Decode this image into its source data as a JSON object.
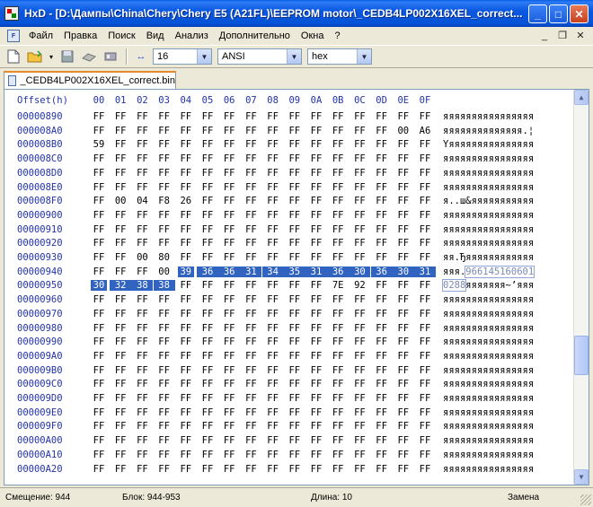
{
  "window": {
    "title": "HxD - [D:\\Дампы\\China\\Chery\\Chery E5 (A21FL)\\EEPROM motor\\_CEDB4LP002X16XEL_correct...",
    "minimize": "_",
    "maximize": "□",
    "close": "✕"
  },
  "menu": {
    "items": [
      "Файл",
      "Правка",
      "Поиск",
      "Вид",
      "Анализ",
      "Дополнительно",
      "Окна",
      "?"
    ],
    "mdi_min": "_",
    "mdi_restore": "❐",
    "mdi_close": "✕"
  },
  "toolbar": {
    "bytes_per_row": "16",
    "charset": "ANSI",
    "offset_base": "hex"
  },
  "tab": {
    "label": "_CEDB4LP002X16XEL_correct.bin"
  },
  "editor": {
    "offset_header": "Offset(h)",
    "columns": [
      "00",
      "01",
      "02",
      "03",
      "04",
      "05",
      "06",
      "07",
      "08",
      "09",
      "0A",
      "0B",
      "0C",
      "0D",
      "0E",
      "0F"
    ],
    "rows": [
      {
        "offset": "00000890",
        "bytes": [
          "FF",
          "FF",
          "FF",
          "FF",
          "FF",
          "FF",
          "FF",
          "FF",
          "FF",
          "FF",
          "FF",
          "FF",
          "FF",
          "FF",
          "FF",
          "FF"
        ],
        "ascii": "яяяяяяяяяяяяяяяя"
      },
      {
        "offset": "000008A0",
        "bytes": [
          "FF",
          "FF",
          "FF",
          "FF",
          "FF",
          "FF",
          "FF",
          "FF",
          "FF",
          "FF",
          "FF",
          "FF",
          "FF",
          "FF",
          "00",
          "A6"
        ],
        "ascii": "яяяяяяяяяяяяяя.¦"
      },
      {
        "offset": "000008B0",
        "bytes": [
          "59",
          "FF",
          "FF",
          "FF",
          "FF",
          "FF",
          "FF",
          "FF",
          "FF",
          "FF",
          "FF",
          "FF",
          "FF",
          "FF",
          "FF",
          "FF"
        ],
        "ascii": "Yяяяяяяяяяяяяяяя"
      },
      {
        "offset": "000008C0",
        "bytes": [
          "FF",
          "FF",
          "FF",
          "FF",
          "FF",
          "FF",
          "FF",
          "FF",
          "FF",
          "FF",
          "FF",
          "FF",
          "FF",
          "FF",
          "FF",
          "FF"
        ],
        "ascii": "яяяяяяяяяяяяяяяя"
      },
      {
        "offset": "000008D0",
        "bytes": [
          "FF",
          "FF",
          "FF",
          "FF",
          "FF",
          "FF",
          "FF",
          "FF",
          "FF",
          "FF",
          "FF",
          "FF",
          "FF",
          "FF",
          "FF",
          "FF"
        ],
        "ascii": "яяяяяяяяяяяяяяяя"
      },
      {
        "offset": "000008E0",
        "bytes": [
          "FF",
          "FF",
          "FF",
          "FF",
          "FF",
          "FF",
          "FF",
          "FF",
          "FF",
          "FF",
          "FF",
          "FF",
          "FF",
          "FF",
          "FF",
          "FF"
        ],
        "ascii": "яяяяяяяяяяяяяяяя"
      },
      {
        "offset": "000008F0",
        "bytes": [
          "FF",
          "00",
          "04",
          "F8",
          "26",
          "FF",
          "FF",
          "FF",
          "FF",
          "FF",
          "FF",
          "FF",
          "FF",
          "FF",
          "FF",
          "FF"
        ],
        "ascii": "я..ш&яяяяяяяяяяя"
      },
      {
        "offset": "00000900",
        "bytes": [
          "FF",
          "FF",
          "FF",
          "FF",
          "FF",
          "FF",
          "FF",
          "FF",
          "FF",
          "FF",
          "FF",
          "FF",
          "FF",
          "FF",
          "FF",
          "FF"
        ],
        "ascii": "яяяяяяяяяяяяяяяя"
      },
      {
        "offset": "00000910",
        "bytes": [
          "FF",
          "FF",
          "FF",
          "FF",
          "FF",
          "FF",
          "FF",
          "FF",
          "FF",
          "FF",
          "FF",
          "FF",
          "FF",
          "FF",
          "FF",
          "FF"
        ],
        "ascii": "яяяяяяяяяяяяяяяя"
      },
      {
        "offset": "00000920",
        "bytes": [
          "FF",
          "FF",
          "FF",
          "FF",
          "FF",
          "FF",
          "FF",
          "FF",
          "FF",
          "FF",
          "FF",
          "FF",
          "FF",
          "FF",
          "FF",
          "FF"
        ],
        "ascii": "яяяяяяяяяяяяяяяя"
      },
      {
        "offset": "00000930",
        "bytes": [
          "FF",
          "FF",
          "00",
          "80",
          "FF",
          "FF",
          "FF",
          "FF",
          "FF",
          "FF",
          "FF",
          "FF",
          "FF",
          "FF",
          "FF",
          "FF"
        ],
        "ascii": "яя.Ђяяяяяяяяяяяя"
      },
      {
        "offset": "00000940",
        "bytes": [
          "FF",
          "FF",
          "FF",
          "00",
          "39",
          "36",
          "36",
          "31",
          "34",
          "35",
          "31",
          "36",
          "30",
          "36",
          "30",
          "31"
        ],
        "ascii_plain": "яяя.",
        "ascii_sel": "966145160601"
      },
      {
        "offset": "00000950",
        "bytes": [
          "30",
          "32",
          "38",
          "38",
          "FF",
          "FF",
          "FF",
          "FF",
          "FF",
          "FF",
          "FF",
          "7E",
          "92",
          "FF",
          "FF",
          "FF"
        ],
        "ascii_sel": "0288",
        "ascii_plain": "яяяяяяя~’яяя"
      },
      {
        "offset": "00000960",
        "bytes": [
          "FF",
          "FF",
          "FF",
          "FF",
          "FF",
          "FF",
          "FF",
          "FF",
          "FF",
          "FF",
          "FF",
          "FF",
          "FF",
          "FF",
          "FF",
          "FF"
        ],
        "ascii": "яяяяяяяяяяяяяяяя"
      },
      {
        "offset": "00000970",
        "bytes": [
          "FF",
          "FF",
          "FF",
          "FF",
          "FF",
          "FF",
          "FF",
          "FF",
          "FF",
          "FF",
          "FF",
          "FF",
          "FF",
          "FF",
          "FF",
          "FF"
        ],
        "ascii": "яяяяяяяяяяяяяяяя"
      },
      {
        "offset": "00000980",
        "bytes": [
          "FF",
          "FF",
          "FF",
          "FF",
          "FF",
          "FF",
          "FF",
          "FF",
          "FF",
          "FF",
          "FF",
          "FF",
          "FF",
          "FF",
          "FF",
          "FF"
        ],
        "ascii": "яяяяяяяяяяяяяяяя"
      },
      {
        "offset": "00000990",
        "bytes": [
          "FF",
          "FF",
          "FF",
          "FF",
          "FF",
          "FF",
          "FF",
          "FF",
          "FF",
          "FF",
          "FF",
          "FF",
          "FF",
          "FF",
          "FF",
          "FF"
        ],
        "ascii": "яяяяяяяяяяяяяяяя"
      },
      {
        "offset": "000009A0",
        "bytes": [
          "FF",
          "FF",
          "FF",
          "FF",
          "FF",
          "FF",
          "FF",
          "FF",
          "FF",
          "FF",
          "FF",
          "FF",
          "FF",
          "FF",
          "FF",
          "FF"
        ],
        "ascii": "яяяяяяяяяяяяяяяя"
      },
      {
        "offset": "000009B0",
        "bytes": [
          "FF",
          "FF",
          "FF",
          "FF",
          "FF",
          "FF",
          "FF",
          "FF",
          "FF",
          "FF",
          "FF",
          "FF",
          "FF",
          "FF",
          "FF",
          "FF"
        ],
        "ascii": "яяяяяяяяяяяяяяяя"
      },
      {
        "offset": "000009C0",
        "bytes": [
          "FF",
          "FF",
          "FF",
          "FF",
          "FF",
          "FF",
          "FF",
          "FF",
          "FF",
          "FF",
          "FF",
          "FF",
          "FF",
          "FF",
          "FF",
          "FF"
        ],
        "ascii": "яяяяяяяяяяяяяяяя"
      },
      {
        "offset": "000009D0",
        "bytes": [
          "FF",
          "FF",
          "FF",
          "FF",
          "FF",
          "FF",
          "FF",
          "FF",
          "FF",
          "FF",
          "FF",
          "FF",
          "FF",
          "FF",
          "FF",
          "FF"
        ],
        "ascii": "яяяяяяяяяяяяяяяя"
      },
      {
        "offset": "000009E0",
        "bytes": [
          "FF",
          "FF",
          "FF",
          "FF",
          "FF",
          "FF",
          "FF",
          "FF",
          "FF",
          "FF",
          "FF",
          "FF",
          "FF",
          "FF",
          "FF",
          "FF"
        ],
        "ascii": "яяяяяяяяяяяяяяяя"
      },
      {
        "offset": "000009F0",
        "bytes": [
          "FF",
          "FF",
          "FF",
          "FF",
          "FF",
          "FF",
          "FF",
          "FF",
          "FF",
          "FF",
          "FF",
          "FF",
          "FF",
          "FF",
          "FF",
          "FF"
        ],
        "ascii": "яяяяяяяяяяяяяяяя"
      },
      {
        "offset": "00000A00",
        "bytes": [
          "FF",
          "FF",
          "FF",
          "FF",
          "FF",
          "FF",
          "FF",
          "FF",
          "FF",
          "FF",
          "FF",
          "FF",
          "FF",
          "FF",
          "FF",
          "FF"
        ],
        "ascii": "яяяяяяяяяяяяяяяя"
      },
      {
        "offset": "00000A10",
        "bytes": [
          "FF",
          "FF",
          "FF",
          "FF",
          "FF",
          "FF",
          "FF",
          "FF",
          "FF",
          "FF",
          "FF",
          "FF",
          "FF",
          "FF",
          "FF",
          "FF"
        ],
        "ascii": "яяяяяяяяяяяяяяяя"
      },
      {
        "offset": "00000A20",
        "bytes": [
          "FF",
          "FF",
          "FF",
          "FF",
          "FF",
          "FF",
          "FF",
          "FF",
          "FF",
          "FF",
          "FF",
          "FF",
          "FF",
          "FF",
          "FF",
          "FF"
        ],
        "ascii": "яяяяяяяяяяяяяяяя"
      }
    ]
  },
  "status": {
    "offset": "Смещение: 944",
    "block": "Блок: 944-953",
    "length": "Длина: 10",
    "mode": "Замена"
  },
  "colors": {
    "accent_header": "#2233aa",
    "selection": "#3163c0",
    "titlebar": "#0a58e0"
  }
}
